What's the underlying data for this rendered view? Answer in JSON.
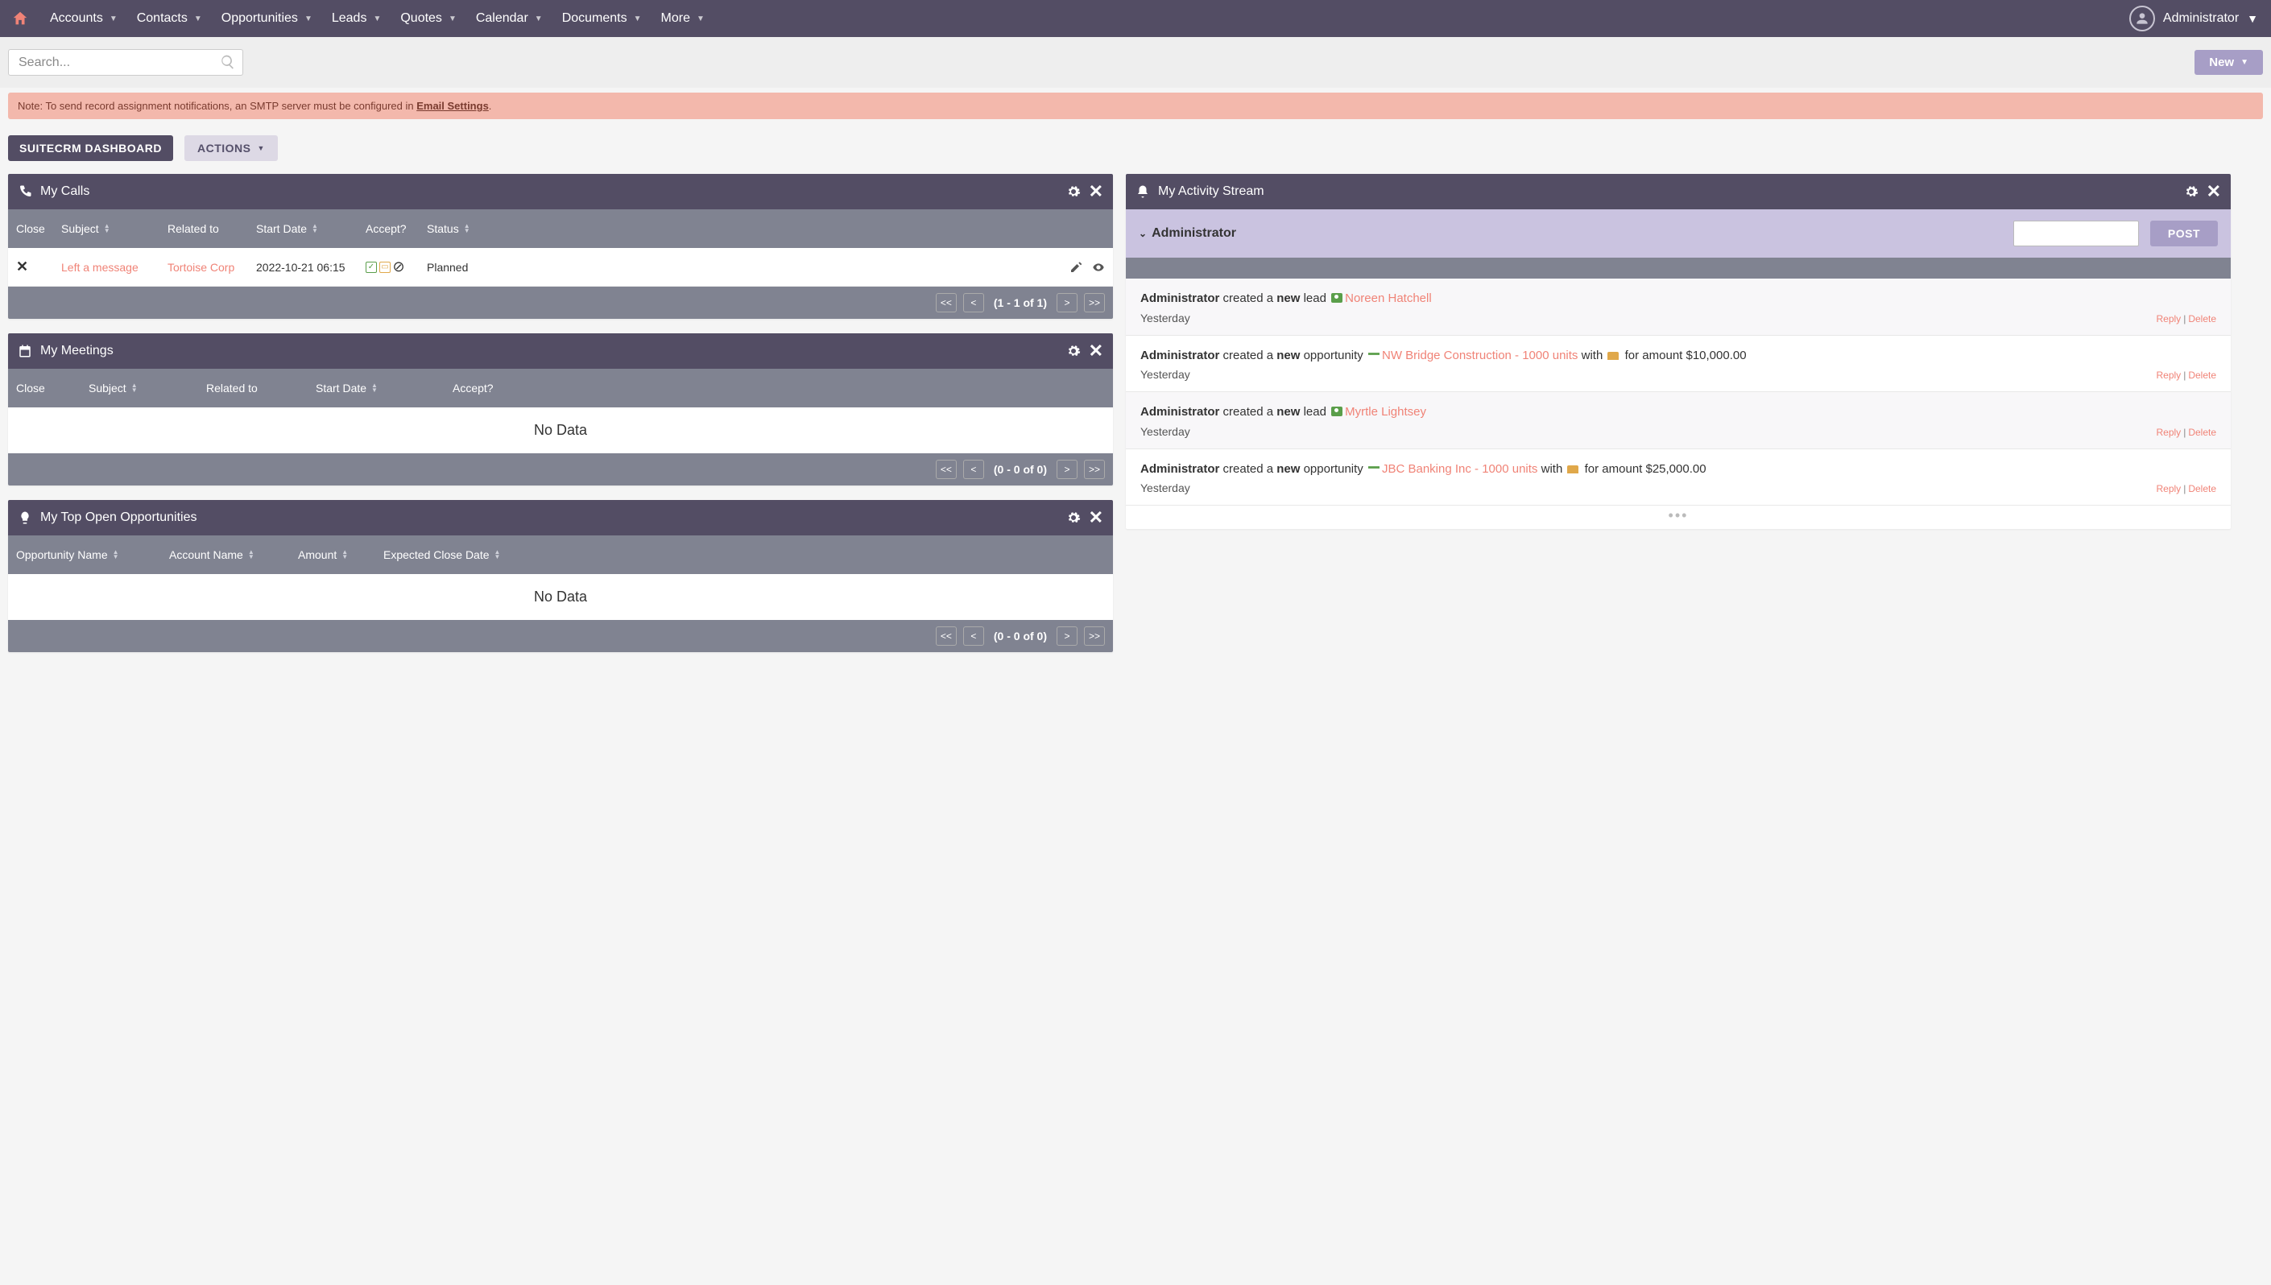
{
  "nav": {
    "items": [
      "Accounts",
      "Contacts",
      "Opportunities",
      "Leads",
      "Quotes",
      "Calendar",
      "Documents",
      "More"
    ],
    "user": "Administrator"
  },
  "search": {
    "placeholder": "Search..."
  },
  "new_btn": "New",
  "alert": {
    "prefix": "Note: To send record assignment notifications, an SMTP server must be configured in ",
    "link": "Email Settings",
    "suffix": "."
  },
  "dashboard": {
    "title": "SUITECRM DASHBOARD",
    "actions": "ACTIONS"
  },
  "calls": {
    "title": "My Calls",
    "cols": {
      "close": "Close",
      "subject": "Subject",
      "related": "Related to",
      "start": "Start Date",
      "accept": "Accept?",
      "status": "Status"
    },
    "row": {
      "subject": "Left a message",
      "related": "Tortoise Corp",
      "start": "2022-10-21 06:15",
      "status": "Planned"
    },
    "pager": {
      "first": "<<",
      "prev": "<",
      "text": "(1 - 1 of 1)",
      "next": ">",
      "last": ">>"
    }
  },
  "meetings": {
    "title": "My Meetings",
    "cols": {
      "close": "Close",
      "subject": "Subject",
      "related": "Related to",
      "start": "Start Date",
      "accept": "Accept?"
    },
    "nodata": "No Data",
    "pager": {
      "first": "<<",
      "prev": "<",
      "text": "(0 - 0 of 0)",
      "next": ">",
      "last": ">>"
    }
  },
  "opps": {
    "title": "My Top Open Opportunities",
    "cols": {
      "name": "Opportunity Name",
      "acct": "Account Name",
      "amt": "Amount",
      "date": "Expected Close Date"
    },
    "nodata": "No Data",
    "pager": {
      "first": "<<",
      "prev": "<",
      "text": "(0 - 0 of 0)",
      "next": ">",
      "last": ">>"
    }
  },
  "activity": {
    "title": "My Activity Stream",
    "post_user": "Administrator",
    "post_btn": "POST",
    "reply": "Reply",
    "delete": "Delete",
    "time": "Yesterday",
    "items": [
      {
        "who": "Administrator",
        "mid1": " created a ",
        "what": "new",
        "mid2": " lead ",
        "icon": "lead",
        "link": "Noreen Hatchell",
        "tail": ""
      },
      {
        "who": "Administrator",
        "mid1": " created a ",
        "what": "new",
        "mid2": " opportunity ",
        "icon": "opp",
        "link": "NW Bridge Construction - 1000 units",
        "tail": " with ",
        "tailIcon": "folder",
        "tail2": " for amount $10,000.00"
      },
      {
        "who": "Administrator",
        "mid1": " created a ",
        "what": "new",
        "mid2": " lead ",
        "icon": "lead",
        "link": "Myrtle Lightsey",
        "tail": ""
      },
      {
        "who": "Administrator",
        "mid1": " created a ",
        "what": "new",
        "mid2": " opportunity ",
        "icon": "opp",
        "link": "JBC Banking Inc - 1000 units",
        "tail": " with ",
        "tailIcon": "folder",
        "tail2": " for amount $25,000.00"
      }
    ]
  }
}
